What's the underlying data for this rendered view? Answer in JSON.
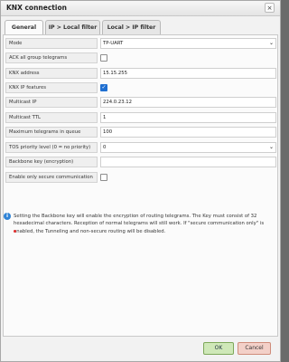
{
  "dialog": {
    "title": "KNX connection",
    "close_glyph": "×"
  },
  "tabs": [
    {
      "label": "General",
      "active": true
    },
    {
      "label": "IP > Local filter",
      "active": false
    },
    {
      "label": "Local > IP filter",
      "active": false
    }
  ],
  "settings": [
    {
      "label": "Mode",
      "type": "select",
      "value": "TP-UART"
    },
    {
      "label": "ACK all group telegrams",
      "type": "checkbox",
      "checked": false
    },
    {
      "label": "KNX address",
      "type": "text",
      "value": "15.15.255"
    },
    {
      "label": "KNX IP features",
      "type": "checkbox",
      "checked": true
    },
    {
      "label": "Multicast IP",
      "type": "text",
      "value": "224.0.23.12"
    },
    {
      "label": "Multicast TTL",
      "type": "text",
      "value": "1"
    },
    {
      "label": "Maximum telegrams in queue",
      "type": "text",
      "value": "100"
    },
    {
      "label": "TOS priority level (0 = no priority)",
      "type": "select",
      "value": "0"
    },
    {
      "label": "Backbone key (encryption)",
      "type": "text",
      "value": ""
    },
    {
      "label": "Enable only secure communication",
      "type": "checkbox",
      "checked": false
    }
  ],
  "info": {
    "text": "Setting the Backbone key will enable the encryption of routing telegrams. The Key must consist of 32 hexadecimal characters. Reception of normal telegrams will still work. If \"secure communication only\" is enabled, the Tunneling and non-secure routing will be disabled.",
    "icon": "info-icon"
  },
  "buttons": {
    "ok": "OK",
    "cancel": "Cancel"
  },
  "colors": {
    "accent": "#1f6fd1",
    "ok_bg": "#cfe8b8",
    "cancel_bg": "#f3d0c8"
  }
}
